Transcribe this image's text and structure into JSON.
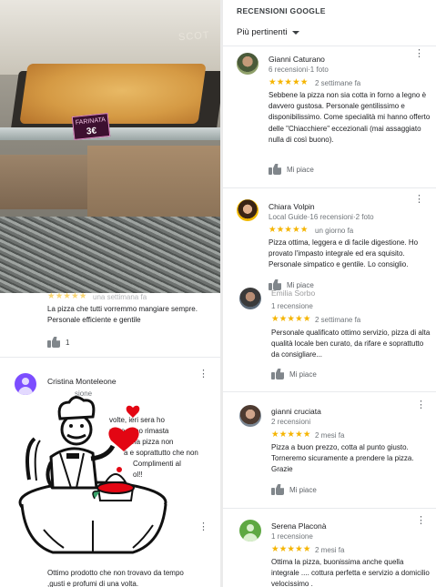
{
  "photo": {
    "price_tag_line1": "FARINATA",
    "price_tag_line2": "3€",
    "sign": "SCOT"
  },
  "left": {
    "review_top": {
      "date_partial": "una settimana fa",
      "text": "La pizza che tutti vorremmo mangiare sempre. Personale efficiente e gentile",
      "likes": "1"
    },
    "review_cristina": {
      "name": "Cristina Monteleone",
      "meta_partial": "sione",
      "text_fragments": [
        "volte, ieri sera ho",
        "ule e sono rimasta",
        "e una pizza non",
        "a e soprattutto che non",
        "Complimenti al",
        "ol!!"
      ]
    },
    "review_bottom": {
      "text_line1": "Ottimo prodotto che non trovavo da tempo",
      "text_line2": ",gusti e profumi di una volta."
    }
  },
  "right": {
    "header": {
      "title": "RECENSIONI GOOGLE",
      "sort_label": "Più pertinenti"
    },
    "reviews": [
      {
        "name": "Gianni Caturano",
        "meta": "6 recensioni·1 foto",
        "stars": "★★★★★",
        "date": "2 settimane fa",
        "text": "Sebbene la pizza non sia cotta in forno a legno è davvero gustosa. Personale gentilissimo e disponibilissimo. Come specialità mi hanno offerto delle \"Chiacchiere\" eccezionali (mai assaggiato nulla di così buono).",
        "like_label": "Mi piace"
      },
      {
        "name": "Chiara Volpin",
        "meta_local": "Local Guide",
        "meta_rest": "·16 recensioni·2 foto",
        "stars": "★★★★★",
        "date": "un giorno fa",
        "text": "Pizza ottima, leggera e di facile digestione. Ho provato l'impasto integrale ed era squisito. Personale simpatico e gentile. Lo consiglio.",
        "like_label": "Mi piace"
      },
      {
        "name_partial": "Emilia Sorbo",
        "meta": "1 recensione",
        "stars": "★★★★★",
        "date": "2 settimane fa",
        "text": "Personale qualificato ottimo servizio, pizza di alta qualità locale ben curato, da rifare e soprattutto da consigliare...",
        "like_label": "Mi piace"
      },
      {
        "name": "gianni cruciata",
        "meta": "2 recensioni",
        "stars": "★★★★★",
        "date": "2 mesi fa",
        "text": "Pizza a buon prezzo, cotta al punto giusto. Torneremo sicuramente a prendere la pizza. Grazie",
        "like_label": "Mi piace"
      },
      {
        "name": "Serena Placonà",
        "meta": "1 recensione",
        "stars": "★★★★★",
        "date": "2 mesi fa",
        "text": "Ottima la pizza, buonissima anche quella integrale .... cottura perfetta e servizio a domicilio velocissimo ."
      }
    ]
  },
  "colors": {
    "star": "#f5b400",
    "meta": "#70757a",
    "avatar_purple": "#7c4dff",
    "avatar_green": "#5ea842"
  },
  "icons": [
    "thumb-up-icon",
    "more-vert-icon",
    "dropdown-caret-icon",
    "chef-illustration",
    "heart-icon"
  ]
}
